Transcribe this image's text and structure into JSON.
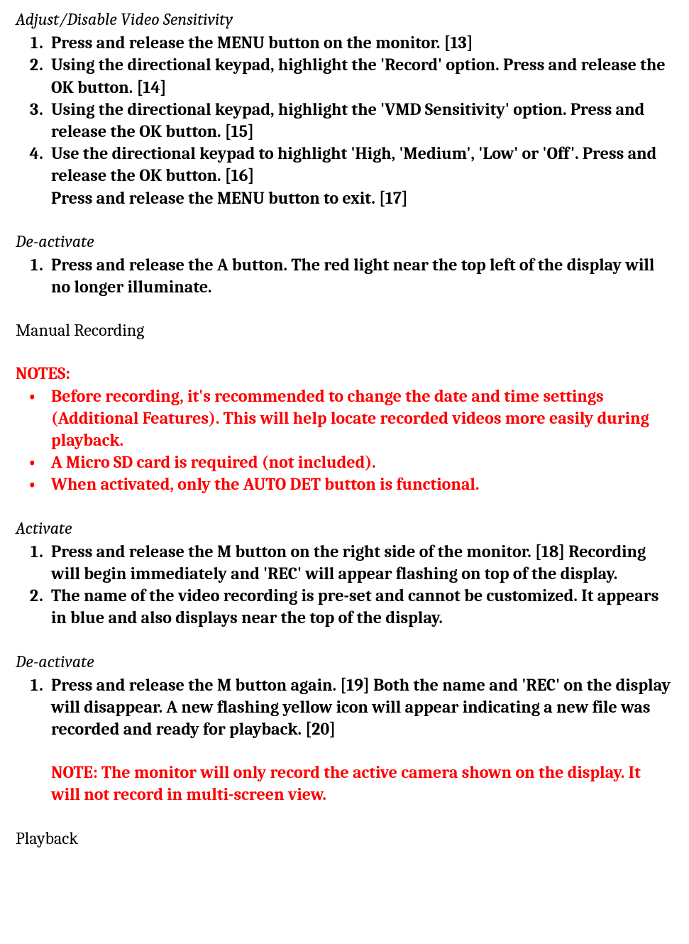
{
  "sec1": {
    "title": "Adjust/Disable Video Sensitivity",
    "items": [
      "Press and release the MENU button on the monitor. [13]",
      "Using the directional keypad, highlight the 'Record' option. Press and release the OK button. [14]",
      "Using the directional keypad, highlight the 'VMD Sensitivity' option. Press and release the OK button. [15]",
      "Use the directional keypad to highlight 'High, 'Medium', 'Low' or 'Off'. Press and release the OK button. [16]"
    ],
    "trailing": "Press and release the MENU button to exit. [17]"
  },
  "sec2": {
    "title": "De-activate",
    "items": [
      "Press and release the A button. The red light near the top left of the display will no longer illuminate."
    ]
  },
  "manual_heading": "Manual Recording",
  "notes": {
    "heading": "NOTES:",
    "bullets": [
      "Before recording, it's recommended to change the date and time settings (Additional Features). This will help locate recorded videos more easily during playback.",
      "A Micro SD card is required (not included).",
      "When activated, only the AUTO DET button is functional."
    ]
  },
  "sec3": {
    "title": "Activate",
    "items": [
      "Press and release the M button on the right side of the monitor.  [18] Recording will begin immediately and 'REC' will appear flashing on top of the display.",
      "The name of the video recording is pre-set and cannot be customized. It appears in blue and also displays near the top of the display."
    ]
  },
  "sec4": {
    "title": "De-activate",
    "items": [
      "Press and release the M button again. [19] Both the name and 'REC' on the display will disappear. A new flashing yellow icon will appear indicating a new file was recorded and ready for playback. [20]"
    ],
    "note": "NOTE: The monitor will only record the active camera shown on the display. It will not record in multi-screen view."
  },
  "playback_heading": "Playback"
}
